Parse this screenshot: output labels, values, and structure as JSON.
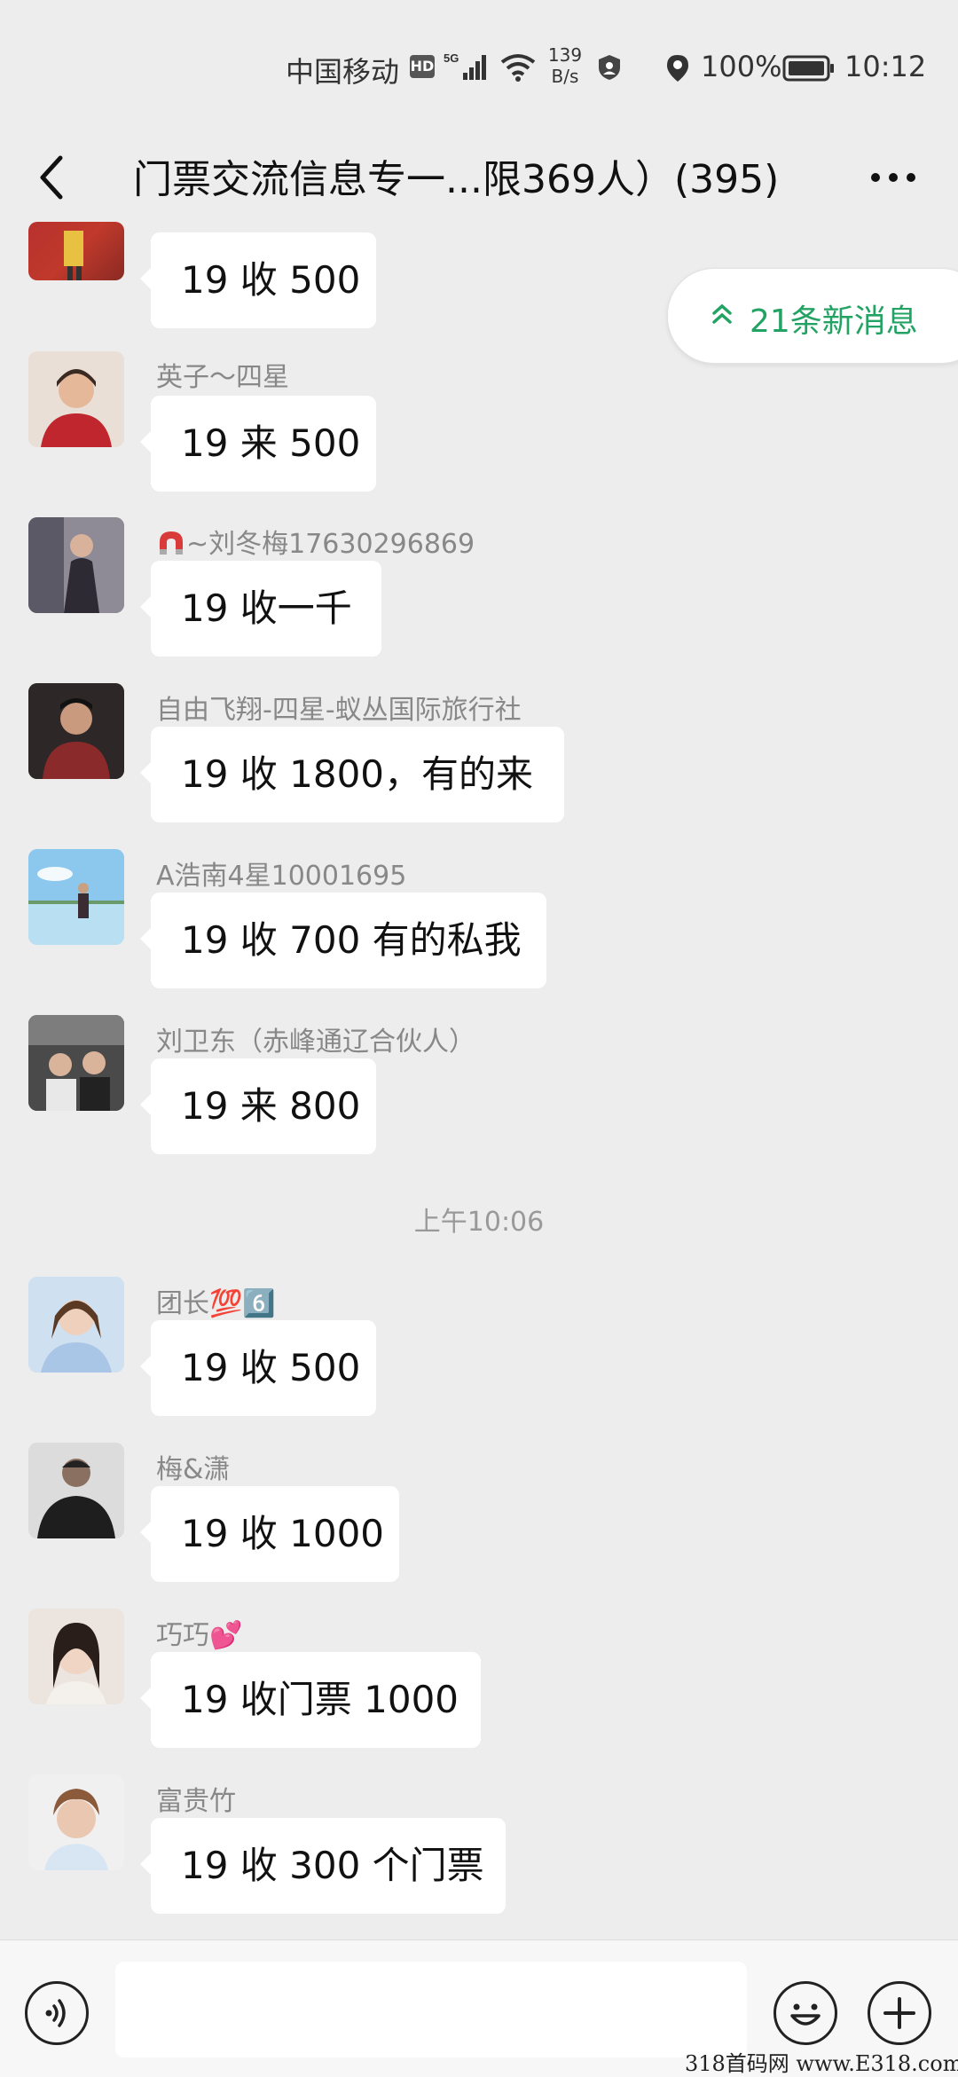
{
  "status_bar": {
    "carrier": "中国移动",
    "hd": "HD",
    "net_type": "5G",
    "net_speed_value": "139",
    "net_speed_unit": "B/s",
    "battery": "100%",
    "time": "10:12",
    "icons": [
      "signal-icon",
      "wifi-icon",
      "shield-icon",
      "location-icon",
      "battery-icon"
    ]
  },
  "header": {
    "title": "门票交流信息专一...限369人）(395)",
    "back_icon": "chevron-left-icon",
    "more_icon": "more-dots-icon"
  },
  "new_messages": {
    "label": "21条新消息",
    "icon": "double-chevron-up-icon",
    "color": "#23a363"
  },
  "messages": [
    {
      "sender": "",
      "text": "19 收 500"
    },
    {
      "sender": "英子～四星",
      "text": "19 来 500"
    },
    {
      "sender": "~刘冬梅17630296869",
      "text": "19 收一千"
    },
    {
      "sender": "自由飞翔-四星-蚁丛国际旅行社",
      "text": "19 收 1800，有的来"
    },
    {
      "sender": "A浩南4星10001695",
      "text": "19 收 700 有的私我"
    },
    {
      "sender": "刘卫东（赤峰通辽合伙人）",
      "text": "19 来 800"
    },
    {
      "sender": "团长💯6️⃣",
      "text": "19 收 500"
    },
    {
      "sender": "梅&潇",
      "text": "19 收 1000"
    },
    {
      "sender": "巧巧💕",
      "text": "19 收门票 1000"
    },
    {
      "sender": "富贵竹",
      "text": "19 收 300 个门票"
    }
  ],
  "timestamp": "上午10:06",
  "bottom_bar": {
    "input_value": "",
    "icons": [
      "voice-icon",
      "emoji-icon",
      "plus-icon"
    ]
  },
  "watermark": "318首码网 www.E318.com"
}
